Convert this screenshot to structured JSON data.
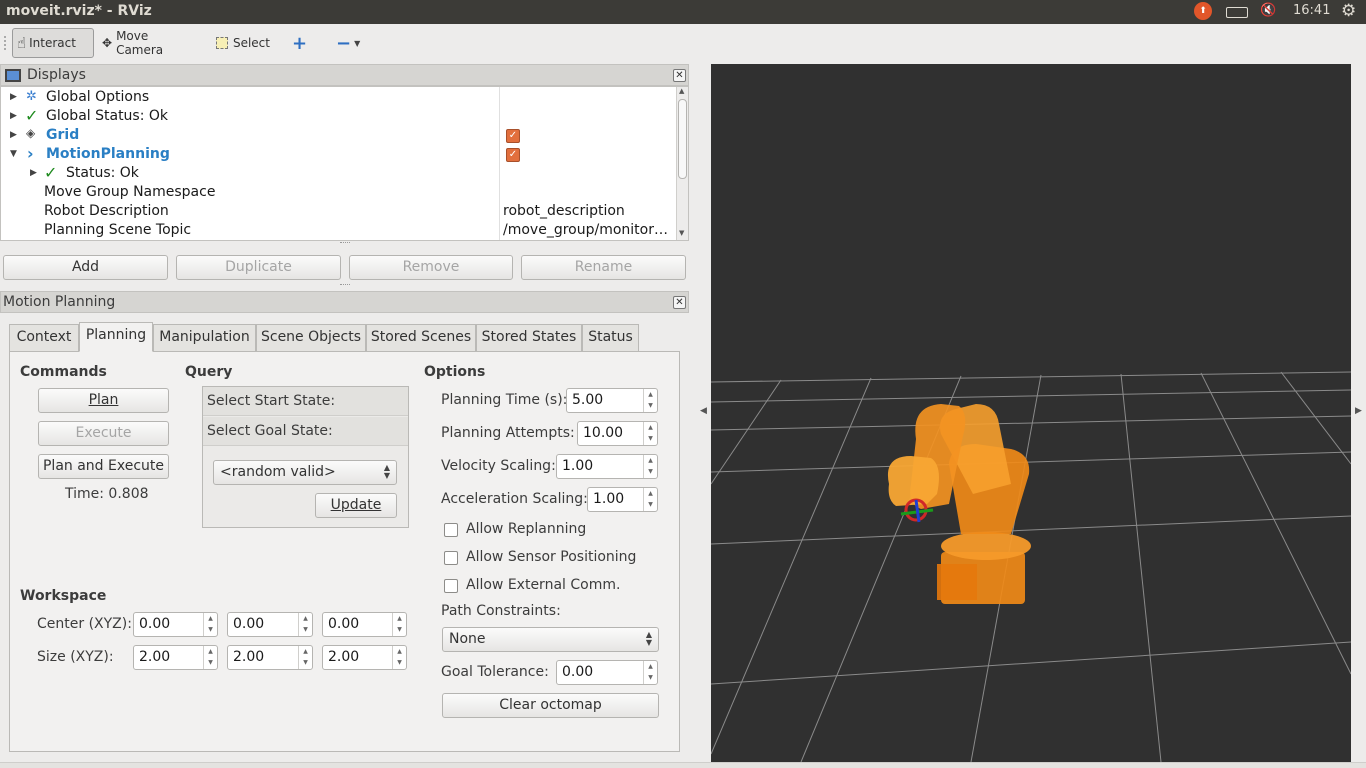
{
  "window": {
    "title": "moveit.rviz* - RViz"
  },
  "tray": {
    "clock": "16:41"
  },
  "toolbar": {
    "interact": "Interact",
    "move_camera": "Move Camera",
    "select": "Select"
  },
  "displays": {
    "header": "Displays",
    "rows": [
      {
        "label": "Global Options",
        "value": ""
      },
      {
        "label": "Global Status: Ok",
        "value": ""
      },
      {
        "label": "Grid",
        "value": ""
      },
      {
        "label": "MotionPlanning",
        "value": ""
      },
      {
        "label": "Status: Ok",
        "value": ""
      },
      {
        "label": "Move Group Namespace",
        "value": ""
      },
      {
        "label": "Robot Description",
        "value": "robot_description"
      },
      {
        "label": "Planning Scene Topic",
        "value": "/move_group/monitor…"
      }
    ],
    "buttons": {
      "add": "Add",
      "duplicate": "Duplicate",
      "remove": "Remove",
      "rename": "Rename"
    }
  },
  "motion_planning": {
    "header": "Motion Planning",
    "tabs": [
      "Context",
      "Planning",
      "Manipulation",
      "Scene Objects",
      "Stored Scenes",
      "Stored States",
      "Status"
    ],
    "selected_tab": "Planning",
    "commands": {
      "title": "Commands",
      "plan": "Plan",
      "execute": "Execute",
      "plan_and_execute": "Plan and Execute",
      "time": "Time: 0.808"
    },
    "query": {
      "title": "Query",
      "start_state": "Select Start State:",
      "goal_state": "Select Goal State:",
      "goal_combo": "<random valid>",
      "update": "Update"
    },
    "options": {
      "title": "Options",
      "planning_time_label": "Planning Time (s):",
      "planning_time": "5.00",
      "planning_attempts_label": "Planning Attempts:",
      "planning_attempts": "10.00",
      "velocity_scaling_label": "Velocity Scaling:",
      "velocity_scaling": "1.00",
      "acceleration_scaling_label": "Acceleration Scaling:",
      "acceleration_scaling": "1.00",
      "allow_replanning": "Allow Replanning",
      "allow_sensor_positioning": "Allow Sensor Positioning",
      "allow_external_comm": "Allow External Comm.",
      "path_constraints_label": "Path Constraints:",
      "path_constraints": "None",
      "goal_tolerance_label": "Goal Tolerance:",
      "goal_tolerance": "0.00",
      "clear_octomap": "Clear octomap"
    },
    "workspace": {
      "title": "Workspace",
      "center_label": "Center (XYZ):",
      "center": [
        "0.00",
        "0.00",
        "0.00"
      ],
      "size_label": "Size (XYZ):",
      "size": [
        "2.00",
        "2.00",
        "2.00"
      ]
    }
  },
  "colors": {
    "robot": "#f08a18",
    "viewport": "#303030",
    "check": "#e26f3d",
    "link_blue": "#2a7fc4"
  }
}
